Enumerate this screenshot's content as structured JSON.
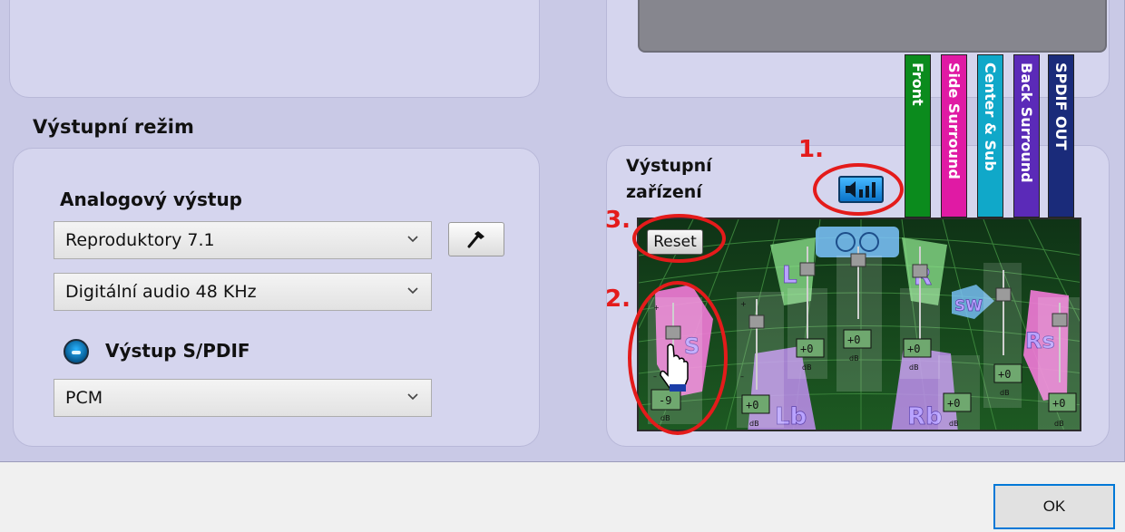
{
  "output_mode": {
    "title": "Výstupní režim",
    "analog_label": "Analogový výstup",
    "speaker_select": "Reproduktory 7.1",
    "sample_rate_select": "Digitální audio 48 KHz",
    "spdif_label": "Výstup S/PDIF",
    "spdif_select": "PCM"
  },
  "output_device": {
    "title_line1": "Výstupní",
    "title_line2": "zařízení",
    "reset_label": "Reset",
    "channel_tabs": [
      {
        "label": "Front",
        "color": "#0b8b1d"
      },
      {
        "label": "Side Surround",
        "color": "#e01aa4"
      },
      {
        "label": "Center & Sub",
        "color": "#10a8c9"
      },
      {
        "label": "Back Surround",
        "color": "#5b2ab8"
      },
      {
        "label": "SPDIF OUT",
        "color": "#1a2b7a"
      }
    ],
    "speakers": {
      "l": "L",
      "r": "R",
      "sw": "SW",
      "s": "S",
      "rs": "Rs",
      "lb": "Lb",
      "rb": "Rb"
    },
    "db_values": {
      "side_left": "-9",
      "back_left": "+0",
      "center_left": "+0",
      "center": "+0",
      "center_right": "+0",
      "sw": "+0",
      "back_right": "+0",
      "side_right": "+0"
    },
    "db_unit": "dB",
    "plus_sign": "+",
    "minus_sign": "–"
  },
  "annotations": [
    "1.",
    "2.",
    "3."
  ],
  "footer": {
    "ok_label": "OK"
  },
  "colors": {
    "annotation": "#e41b1b",
    "dialog_bg": "#c9c9e6",
    "panel_bg": "#d5d5ee",
    "ok_border": "#0078d7"
  }
}
